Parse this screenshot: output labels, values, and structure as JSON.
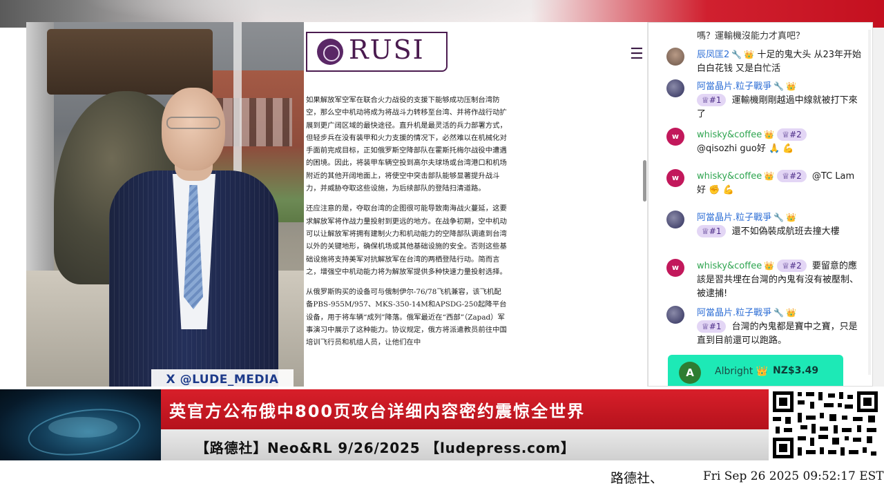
{
  "watermark": "X @LUDE_MEDIA",
  "article": {
    "logo_text": "RUSI",
    "menu_icon": "hamburger-icon",
    "paragraphs": [
      "如果解放军空军在联合火力战役的支援下能够成功压制台湾防空，那么空中机动将成为将战斗力转移至台湾、并将作战行动扩展到更广阔区域的最快途径。直升机是最灵活的兵力部署方式，但轻步兵在没有装甲和火力支援的情况下，必然难以在机械化对手面前完成目标，正如俄罗斯空降部队在霍斯托梅尔战役中遭遇的困境。因此，将装甲车辆空投到高尔夫球场或台湾港口和机场附近的其他开阔地面上，将使空中突击部队能够显著提升战斗力，并威胁夺取这些设施，为后续部队的登陆扫清道路。",
      "还应注意的是，夺取台湾的企图很可能导致南海战火蔓延，这要求解放军将作战力量投射到更远的地方。在战争初期，空中机动可以让解放军将拥有建制火力和机动能力的空降部队调遣到台湾以外的关键地形，确保机场或其他基础设施的安全。否则这些基础设施将支持美军对抗解放军在台湾的两栖登陆行动。简而言之，增强空中机动能力将为解放军提供多种快速力量投射选择。",
      "从俄罗斯购买的设备可与俄制伊尔-76/78飞机兼容，该飞机配备PBS-955M/957、MKS-350-14M和APSDG-250起降平台设备，用于将车辆“成列”降落。俄军最近在“西部”（Zapad）军事演习中展示了这种能力。协议规定，俄方将派遣教员前往中国培训飞行员和机组人员，让他们在中"
    ]
  },
  "chat": {
    "top_text": "嗎？運輸機沒能力才真吧？",
    "messages": [
      {
        "user": "辰凤匡2",
        "rank": "",
        "text": "十足的鬼大头 从23年开始 白白花钱 又是白忙活"
      },
      {
        "user": "阿當晶片.粒子戰爭",
        "rank": "#1",
        "text": "運輸機剛剛越過中線就被打下來了"
      },
      {
        "user": "whisky&coffee",
        "rank": "#2",
        "text": "@qisozhi guo好 🙏 💪"
      },
      {
        "user": "whisky&coffee",
        "rank": "#2",
        "text": "@TC Lam好 ✊ 💪"
      },
      {
        "user": "阿當晶片.粒子戰爭",
        "rank": "#1",
        "text": "還不如偽裝成航班去撞大樓"
      },
      {
        "user": "whisky&coffee",
        "rank": "#2",
        "text": "要留意的應該是習共埋在台灣的內鬼有沒有被壓制、被逮捕!"
      },
      {
        "user": "阿當晶片.粒子戰爭",
        "rank": "#1",
        "text": "台灣的內鬼都是寶中之寶，只是直到目前還可以跑路。"
      }
    ],
    "donation": {
      "avatar_letter": "A",
      "name": "Albright",
      "amount": "NZ$3.49"
    }
  },
  "lower_third": {
    "headline": "英官方公布俄中800页攻台详细内容密约震惊全世界",
    "subline": "【路德社】Neo&RL 9/26/2025 【ludepress.com】"
  },
  "ticker": {
    "text": "路德社、",
    "timestamp": "Fri Sep 26 2025 09:52:17 EST"
  },
  "colors": {
    "headline_red": "#c8161f",
    "rusi_purple": "#4a1b4f",
    "chat_user_green": "#2ea44f",
    "chat_user_blue": "#2f6fd6",
    "donation_teal": "#1de9b6"
  }
}
